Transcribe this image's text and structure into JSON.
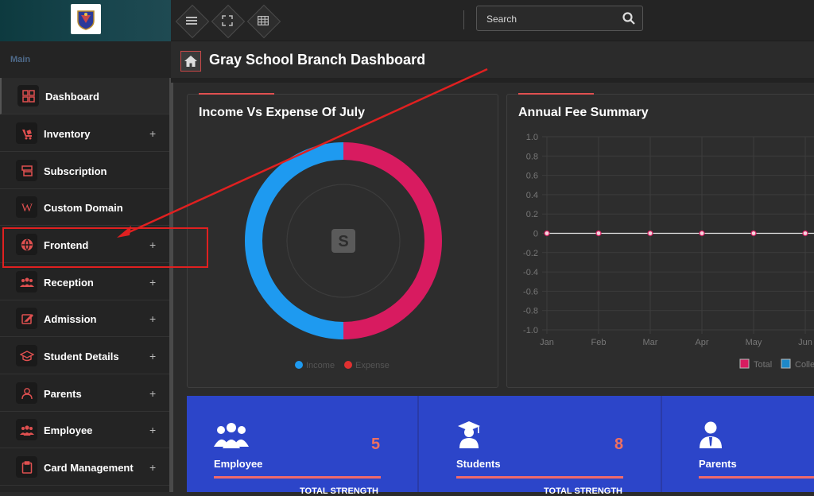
{
  "topbar": {
    "search_placeholder": "Search",
    "icons": [
      "menu-icon",
      "fullscreen-icon",
      "grid-icon",
      "search-icon"
    ]
  },
  "sidebar": {
    "section_label": "Main",
    "items": [
      {
        "label": "Dashboard",
        "icon": "dashboard-icon",
        "expandable": false
      },
      {
        "label": "Inventory",
        "icon": "inventory-icon",
        "expandable": true
      },
      {
        "label": "Subscription",
        "icon": "subscription-icon",
        "expandable": false
      },
      {
        "label": "Custom Domain",
        "icon": "wikipedia-icon",
        "expandable": false
      },
      {
        "label": "Frontend",
        "icon": "globe-icon",
        "expandable": true
      },
      {
        "label": "Reception",
        "icon": "reception-icon",
        "expandable": true
      },
      {
        "label": "Admission",
        "icon": "admission-icon",
        "expandable": true
      },
      {
        "label": "Student Details",
        "icon": "graduation-cap-icon",
        "expandable": true
      },
      {
        "label": "Parents",
        "icon": "user-icon",
        "expandable": true
      },
      {
        "label": "Employee",
        "icon": "employees-icon",
        "expandable": true
      },
      {
        "label": "Card Management",
        "icon": "clipboard-icon",
        "expandable": true
      }
    ],
    "plus_glyph": "+"
  },
  "page": {
    "title": "Gray School Branch Dashboard"
  },
  "cards": {
    "income_expense": {
      "title": "Income Vs Expense Of July"
    },
    "annual_fee": {
      "title": "Annual Fee Summary"
    }
  },
  "chart_data": [
    {
      "type": "pie",
      "title": "Income Vs Expense Of July",
      "categories": [
        "Income",
        "Expense"
      ],
      "values": [
        50,
        50
      ],
      "colors": [
        "#1e9af0",
        "#d81b60"
      ],
      "legend": "bottom"
    },
    {
      "type": "line",
      "title": "Annual Fee Summary",
      "x": [
        "Jan",
        "Feb",
        "Mar",
        "Apr",
        "May",
        "Jun"
      ],
      "ylim": [
        -1.0,
        1.0
      ],
      "yticks": [
        "1.0",
        "0.8",
        "0.6",
        "0.4",
        "0.2",
        "0",
        "-0.2",
        "-0.4",
        "-0.6",
        "-0.8",
        "-1.0"
      ],
      "series": [
        {
          "name": "Total",
          "values": [
            0,
            0,
            0,
            0,
            0,
            0
          ],
          "color": "#d81b60"
        },
        {
          "name": "Colle",
          "values": [
            0,
            0,
            0,
            0,
            0,
            0
          ],
          "color": "#1e88c8"
        }
      ],
      "grid": true,
      "legend": "bottom-right"
    }
  ],
  "stats": [
    {
      "label": "Employee",
      "value": "5",
      "sub": "TOTAL STRENGTH",
      "icon": "employees-icon"
    },
    {
      "label": "Students",
      "value": "8",
      "sub": "TOTAL STRENGTH",
      "icon": "graduate-icon"
    },
    {
      "label": "Parents",
      "value": "",
      "sub": "",
      "icon": "parent-icon"
    }
  ],
  "colors": {
    "accent": "#e05050",
    "stats_bg": "#2c45c9",
    "annotation": "#e02020"
  }
}
